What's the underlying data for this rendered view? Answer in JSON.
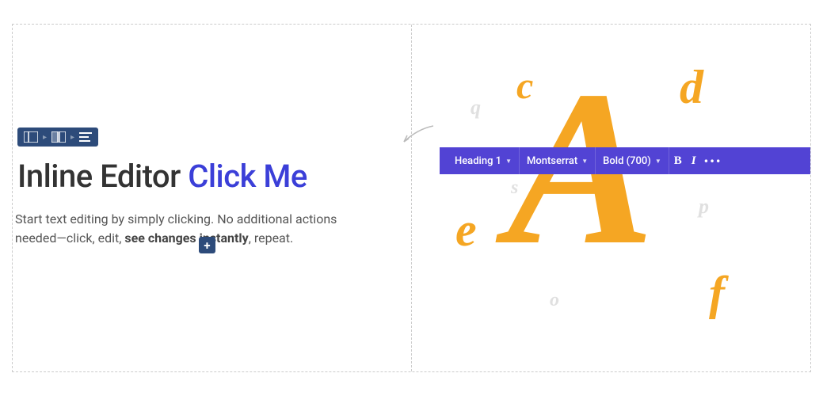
{
  "heading": {
    "prefix": "Inline Editor ",
    "link": "Click Me"
  },
  "paragraph": {
    "p1": "Start text editing by simply clicking. No additional actions needed—click, edit, ",
    "bold": "see changes instantly",
    "p2": ", repeat."
  },
  "toolbar": {
    "style": "Heading 1",
    "font": "Montserrat",
    "weight": "Bold (700)",
    "bold": "B",
    "italic": "I",
    "more": "•••"
  },
  "add_button": "+",
  "letters": {
    "big": "A",
    "c": "c",
    "d": "d",
    "e": "e",
    "f": "f",
    "q": "q",
    "s": "s",
    "p": "p",
    "o": "o"
  }
}
